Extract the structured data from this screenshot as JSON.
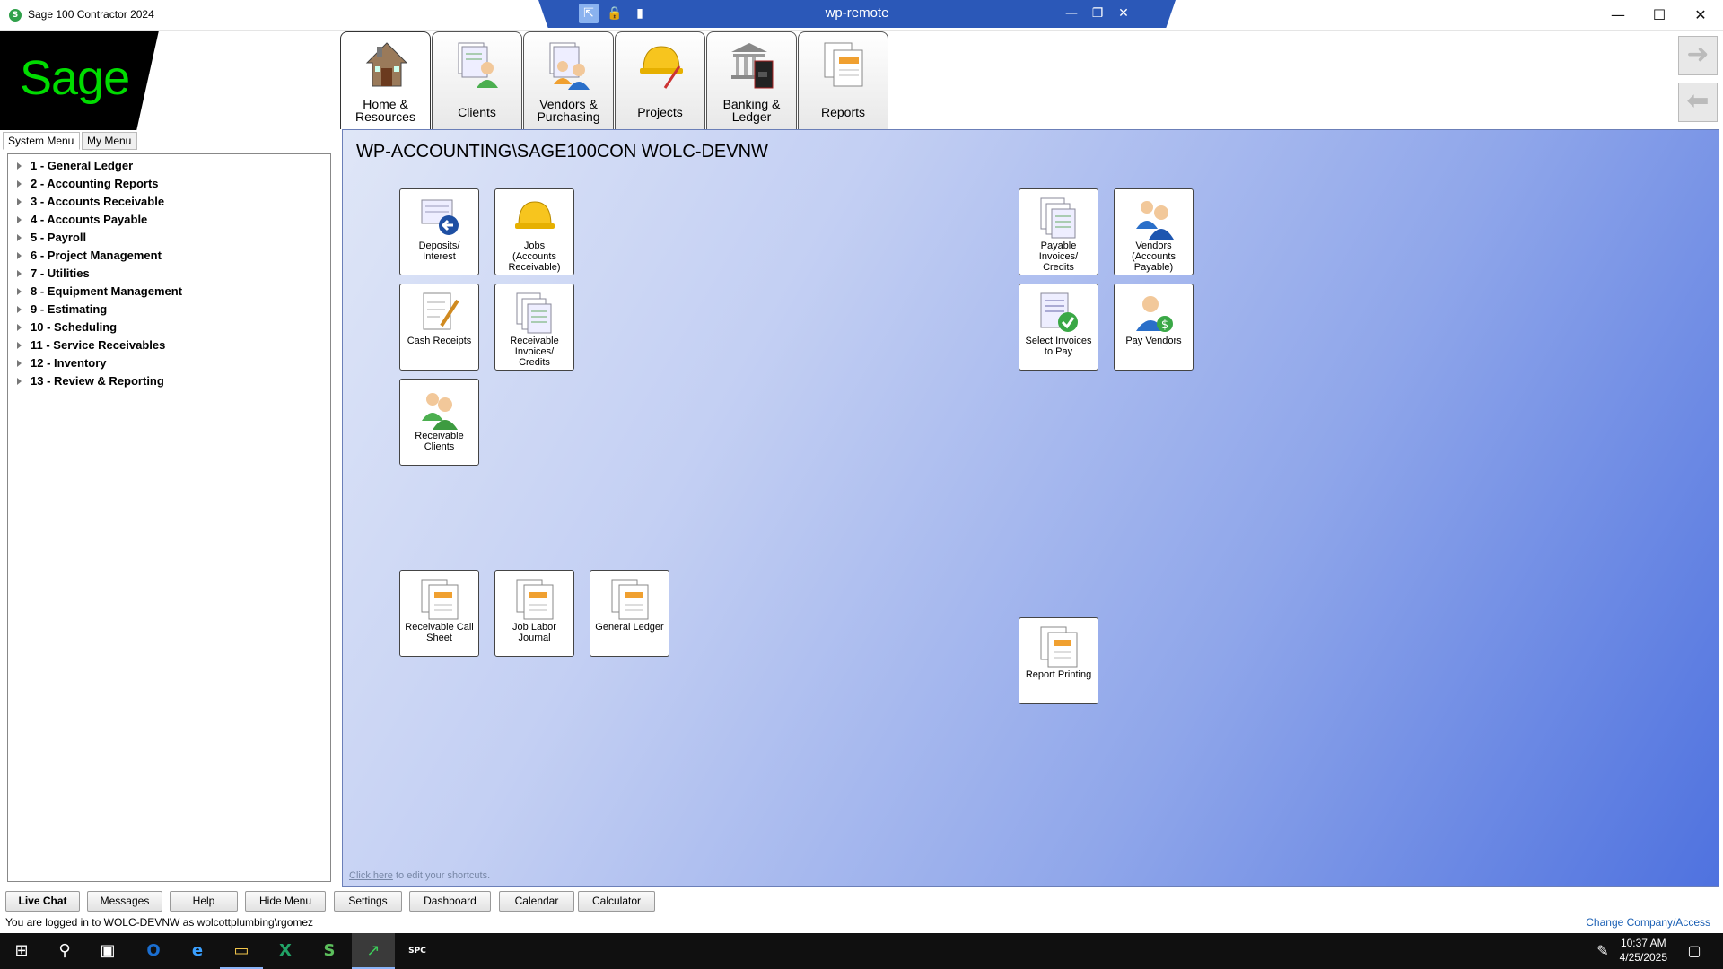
{
  "window": {
    "title": "Sage 100 Contractor 2024",
    "app_icon_glyph": "S",
    "minimize": "—",
    "maximize": "☐",
    "close": "✕"
  },
  "remote_bar": {
    "title": "wp-remote",
    "pin": "⇱",
    "lock": "🔒",
    "signal": "▮",
    "minimize": "—",
    "restore": "❐",
    "close": "✕"
  },
  "logo": {
    "text": "Sage"
  },
  "menu_tabs": [
    "System Menu",
    "My Menu"
  ],
  "tree": [
    "1 - General Ledger",
    "2 - Accounting Reports",
    "3 - Accounts Receivable",
    "4 - Accounts Payable",
    "5 - Payroll",
    "6 - Project Management",
    "7 - Utilities",
    "8 - Equipment Management",
    "9 - Estimating",
    "10 - Scheduling",
    "11 - Service Receivables",
    "12 - Inventory",
    "13 - Review & Reporting"
  ],
  "ribbon_tabs": [
    {
      "line1": "Home &",
      "line2": "Resources",
      "icon": "house-icon"
    },
    {
      "line1": "Clients",
      "line2": "",
      "icon": "clients-icon"
    },
    {
      "line1": "Vendors &",
      "line2": "Purchasing",
      "icon": "vendors-icon"
    },
    {
      "line1": "Projects",
      "line2": "",
      "icon": "hardhat-icon"
    },
    {
      "line1": "Banking &",
      "line2": "Ledger",
      "icon": "bank-icon"
    },
    {
      "line1": "Reports",
      "line2": "",
      "icon": "reports-icon"
    }
  ],
  "nav": {
    "forward": "➜",
    "back": "⬅"
  },
  "main": {
    "title": "WP-ACCOUNTING\\SAGE100CON WOLC-DEVNW",
    "edit_link": "Click here",
    "edit_text": " to edit your shortcuts."
  },
  "shortcuts": [
    {
      "l1": "Deposits/",
      "l2": "Interest",
      "l3": "",
      "icon": "deposit-icon"
    },
    {
      "l1": "Jobs",
      "l2": "(Accounts",
      "l3": "Receivable)",
      "icon": "hardhat-icon"
    },
    {
      "l1": "Cash Receipts",
      "l2": "",
      "l3": "",
      "icon": "receipt-pen-icon"
    },
    {
      "l1": "Receivable",
      "l2": "Invoices/",
      "l3": "Credits",
      "icon": "invoices-icon"
    },
    {
      "l1": "Receivable",
      "l2": "Clients",
      "l3": "",
      "icon": "clients-icon"
    },
    {
      "l1": "Payable",
      "l2": "Invoices/",
      "l3": "Credits",
      "icon": "invoices-icon"
    },
    {
      "l1": "Vendors",
      "l2": "(Accounts",
      "l3": "Payable)",
      "icon": "vendors-icon"
    },
    {
      "l1": "Select Invoices",
      "l2": "to Pay",
      "l3": "",
      "icon": "select-invoice-icon"
    },
    {
      "l1": "Pay Vendors",
      "l2": "",
      "l3": "",
      "icon": "pay-vendor-icon"
    },
    {
      "l1": "Receivable Call",
      "l2": "Sheet",
      "l3": "",
      "icon": "report-icon"
    },
    {
      "l1": "Job Labor",
      "l2": "Journal",
      "l3": "",
      "icon": "report-icon"
    },
    {
      "l1": "General Ledger",
      "l2": "",
      "l3": "",
      "icon": "report-icon"
    },
    {
      "l1": "Report Printing",
      "l2": "",
      "l3": "",
      "icon": "report-icon"
    }
  ],
  "bottom_buttons": [
    "Live Chat",
    "Messages",
    "Help",
    "Hide Menu",
    "Settings",
    "Dashboard",
    "Calendar",
    "Calculator"
  ],
  "status": {
    "logged_in": "You are logged in to WOLC-DEVNW as wolcottplumbing\\rgomez",
    "change_company": "Change Company/Access"
  },
  "taskbar": {
    "start": "⊞",
    "search": "⚲",
    "taskview": "▣",
    "outlook": "O",
    "edge": "e",
    "explorer": "▭",
    "excel": "X",
    "sage_a": "S",
    "sage_b": "↗",
    "spc": "SPC",
    "pen": "✎",
    "notifications": "▢",
    "time": "10:37 AM",
    "date": "4/25/2025"
  },
  "colors": {
    "accent": "#2b58b8",
    "logo_green": "#00dc00",
    "link": "#1a5fb4"
  }
}
